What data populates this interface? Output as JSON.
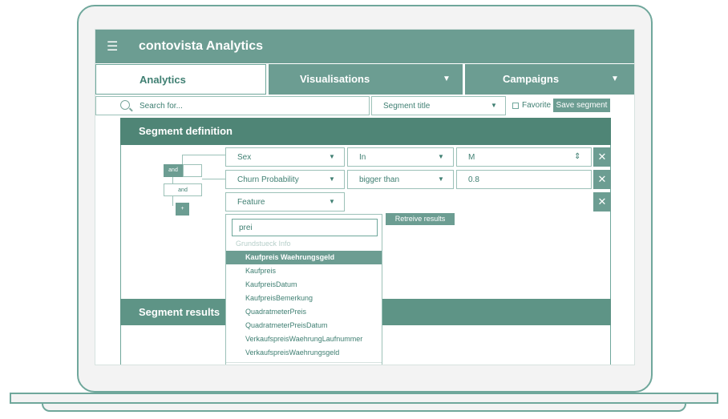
{
  "app": {
    "title": "contovista Analytics"
  },
  "tabs": [
    {
      "label": "Analytics"
    },
    {
      "label": "Visualisations"
    },
    {
      "label": "Campaigns"
    }
  ],
  "toolbar": {
    "search_placeholder": "Search for...",
    "segment_title": "Segment title",
    "favorite_label": "Favorite",
    "save_label": "Save segment"
  },
  "segment_definition": {
    "title": "Segment definition",
    "tree": {
      "and_label": "and",
      "and_label_2": "and",
      "plus_label": "+"
    },
    "rows": [
      {
        "field": "Sex",
        "operator": "In",
        "value": "M"
      },
      {
        "field": "Churn Probability",
        "operator": "bigger than",
        "value": "0.8"
      },
      {
        "field": "Feature"
      }
    ],
    "remove_label": "✕"
  },
  "dropdown": {
    "query": "prei",
    "group": "Grundstueck Info",
    "items": [
      "Kaufpreis Waehrungsgeld",
      "Kaufpreis",
      "KaufpreisDatum",
      "KaufpreisBemerkung",
      "QuadratmeterPreis",
      "QuadratmeterPreisDatum",
      "VerkaufspreisWaehrungLaufnummer",
      "VerkaufspreisWaehrungsgeld"
    ],
    "selected_index": 0
  },
  "retrieve_label": "Retreive results",
  "segment_results": {
    "title": "Segment results"
  },
  "icons": {
    "menu": "☰",
    "caret": "▼",
    "spinner": "⇕",
    "close": "✕"
  },
  "colors": {
    "accent": "#6c9d92",
    "accent_dark": "#4f8576",
    "text": "#3f7f72"
  }
}
